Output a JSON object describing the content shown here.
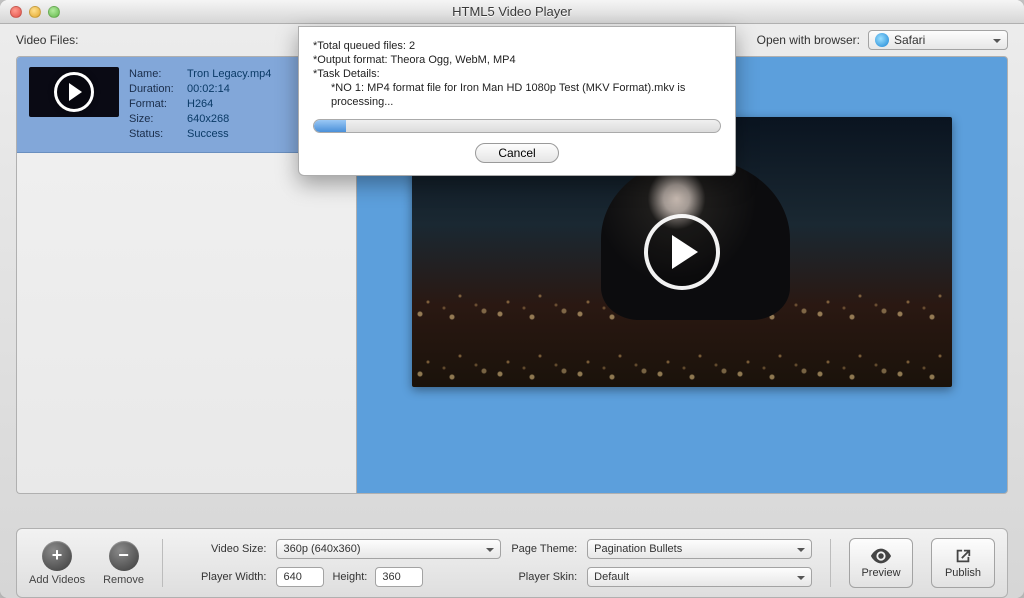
{
  "window": {
    "title": "HTML5 Video Player"
  },
  "top": {
    "files_label": "Video Files:",
    "open_with_label": "Open with browser:",
    "browser": "Safari"
  },
  "video_item": {
    "labels": {
      "name": "Name:",
      "duration": "Duration:",
      "format": "Format:",
      "size": "Size:",
      "status": "Status:"
    },
    "name": "Tron Legacy.mp4",
    "duration": "00:02:14",
    "format": "H264",
    "size": "640x268",
    "status": "Success"
  },
  "dialog": {
    "line1": "*Total queued files: 2",
    "line2": "*Output format: Theora Ogg, WebM, MP4",
    "line3": "*Task Details:",
    "line4": "*NO 1: MP4 format file for Iron Man HD 1080p Test (MKV Format).mkv is processing...",
    "cancel": "Cancel"
  },
  "bottom": {
    "add_videos": "Add Videos",
    "remove": "Remove",
    "video_size_label": "Video Size:",
    "video_size": "360p (640x360)",
    "player_width_label": "Player Width:",
    "player_width": "640",
    "height_label": "Height:",
    "height": "360",
    "page_theme_label": "Page Theme:",
    "page_theme": "Pagination Bullets",
    "player_skin_label": "Player Skin:",
    "player_skin": "Default",
    "preview": "Preview",
    "publish": "Publish"
  }
}
